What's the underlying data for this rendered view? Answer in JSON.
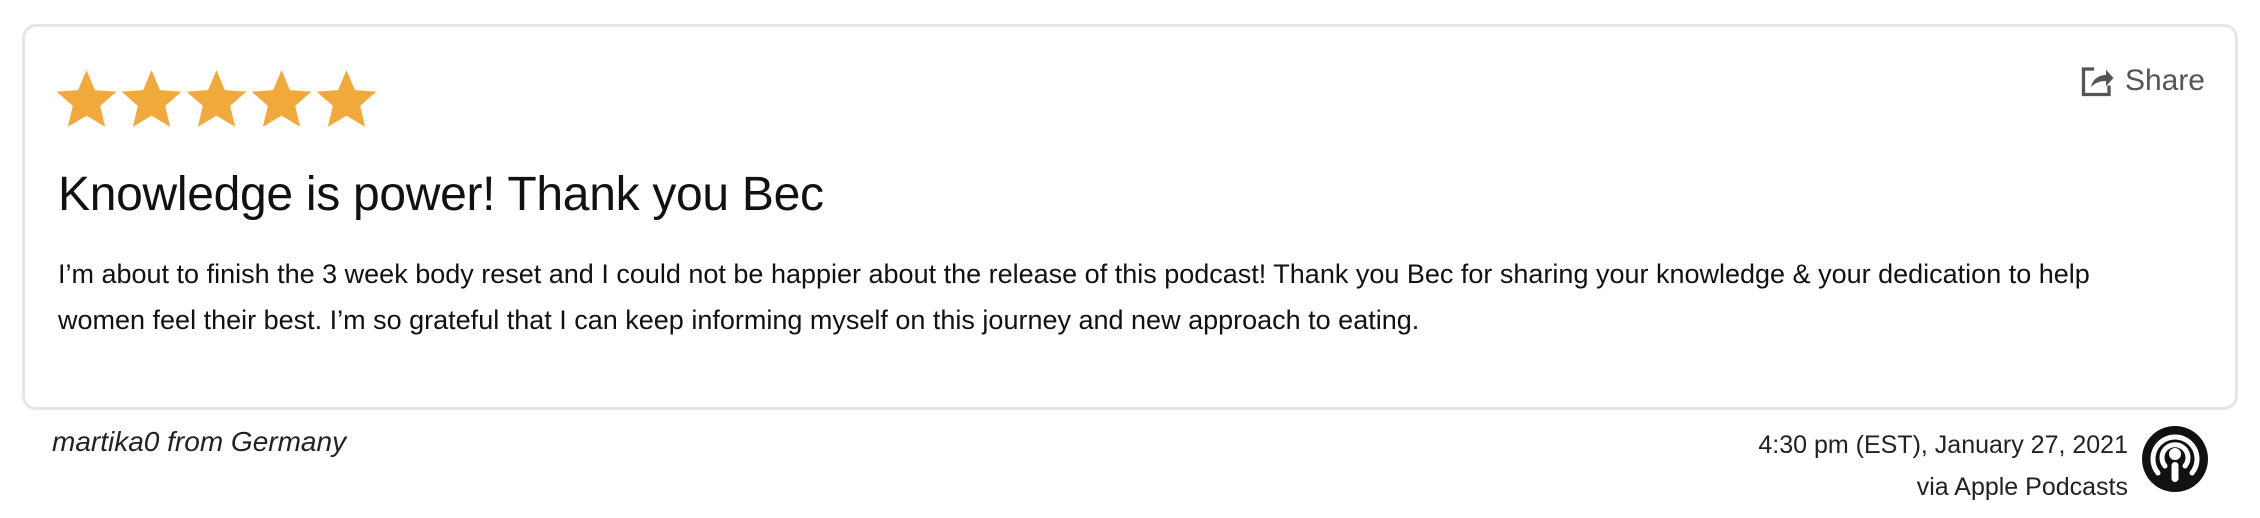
{
  "review": {
    "rating": 5,
    "rating_max": 5,
    "title": "Knowledge is power! Thank you Bec",
    "body": "I’m about to finish the 3 week body reset and I could not be happier about the release of this podcast! Thank you Bec for sharing your knowledge & your dedication to help women feel their best. I’m so grateful that I can keep informing myself on this journey and new approach to eating.",
    "share_label": "Share"
  },
  "footer": {
    "author": "martika0 from Germany",
    "timestamp": "4:30 pm (EST), January 27, 2021",
    "source": "via Apple Podcasts"
  },
  "icons": {
    "star": "star-icon",
    "share": "share-icon",
    "source": "apple-podcasts-icon"
  },
  "colors": {
    "star": "#F2A93B",
    "card_border": "#E6E6E6",
    "text": "#111111"
  }
}
